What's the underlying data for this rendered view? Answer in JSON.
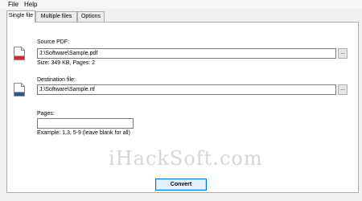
{
  "menu": {
    "file": "File",
    "help": "Help"
  },
  "tabs": [
    {
      "label": "Single file",
      "active": true
    },
    {
      "label": "Multiple files",
      "active": false
    },
    {
      "label": "Options",
      "active": false
    }
  ],
  "source": {
    "label": "Source PDF:",
    "value": "J:\\Software\\Sample.pdf",
    "browse_label": "...",
    "info": "Size: 349 KB, Pages: 2",
    "icon": "pdf-file-icon",
    "accent": "#d9272e"
  },
  "destination": {
    "label": "Destination file:",
    "value": "J:\\Software\\Sample.rtf",
    "browse_label": "...",
    "icon": "rtf-file-icon",
    "accent": "#2b5797"
  },
  "pages": {
    "label": "Pages:",
    "value": "",
    "hint": "Example: 1,3, 5-9 (leave blank for all)"
  },
  "watermark": "iHackSoft.com",
  "convert_label": "Convert"
}
